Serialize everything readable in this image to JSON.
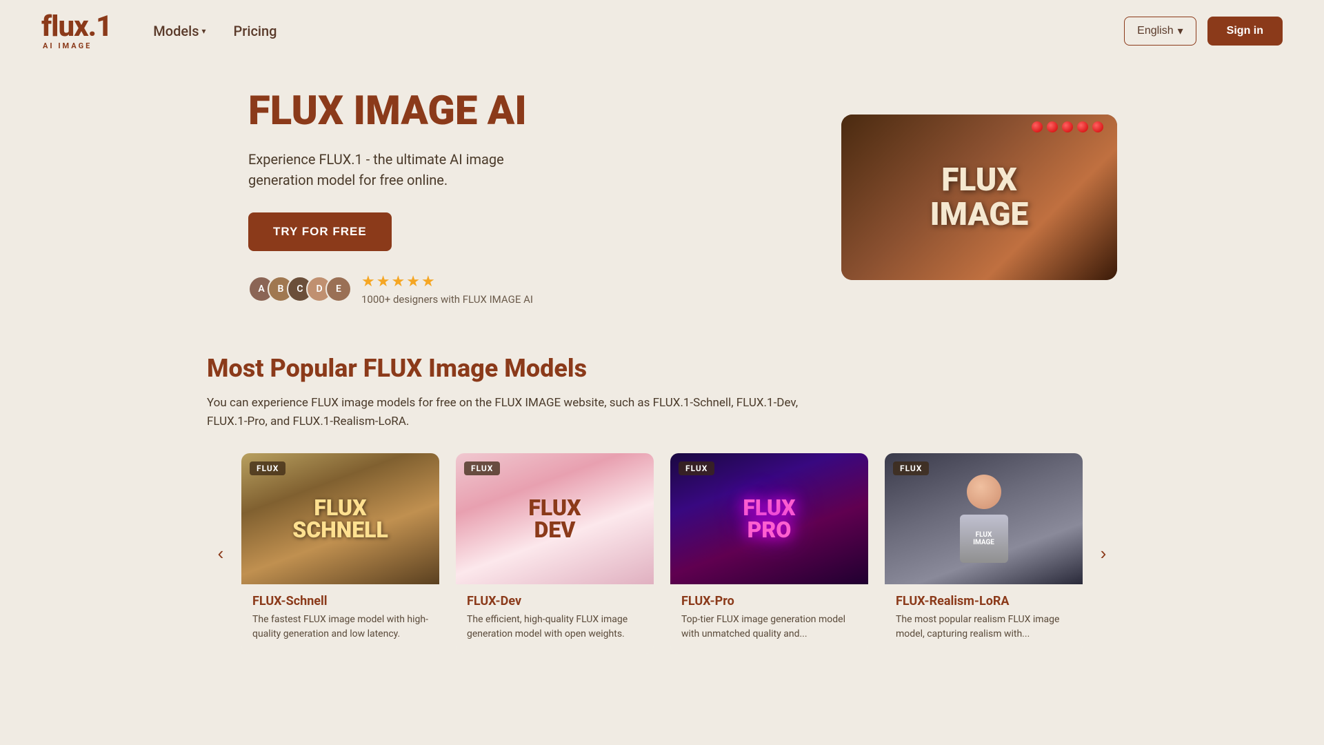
{
  "brand": {
    "logo": "flux.1",
    "sub": "AI IMAGE"
  },
  "nav": {
    "models_label": "Models",
    "pricing_label": "Pricing",
    "language_label": "English",
    "signin_label": "Sign in"
  },
  "hero": {
    "title": "FLUX IMAGE AI",
    "description": "Experience FLUX.1 - the ultimate AI image generation model for free online.",
    "cta": "TRY FOR FREE",
    "social_text": "1000+ designers with FLUX IMAGE AI",
    "stars": [
      "★",
      "★",
      "★",
      "★",
      "★"
    ]
  },
  "models_section": {
    "title": "Most Popular FLUX Image Models",
    "description": "You can experience FLUX image models for free on the FLUX IMAGE website, such as FLUX.1-Schnell, FLUX.1-Dev, FLUX.1-Pro, and FLUX.1-Realism-LoRA.",
    "carousel_prev": "‹",
    "carousel_next": "›",
    "models": [
      {
        "badge": "FLUX",
        "name": "FLUX-Schnell",
        "description": "The fastest FLUX image model with high-quality generation and low latency.",
        "img_label": "FLUX\nSCHNELL",
        "theme": "schnell"
      },
      {
        "badge": "FLUX",
        "name": "FLUX-Dev",
        "description": "The efficient, high-quality FLUX image generation model with open weights.",
        "img_label": "FLUX\nDEV",
        "theme": "dev"
      },
      {
        "badge": "FLUX",
        "name": "FLUX-Pro",
        "description": "Top-tier FLUX image generation model with unmatched quality and...",
        "img_label": "FLUX\nPRO",
        "theme": "pro"
      },
      {
        "badge": "FLUX",
        "name": "FLUX-Realism-LoRA",
        "description": "The most popular realism FLUX image model, capturing realism with...",
        "img_label": "FLUX\nIMAGE",
        "theme": "realism"
      }
    ]
  },
  "colors": {
    "primary": "#8b3a1a",
    "bg": "#f0ebe3",
    "text": "#4a3a2a"
  }
}
